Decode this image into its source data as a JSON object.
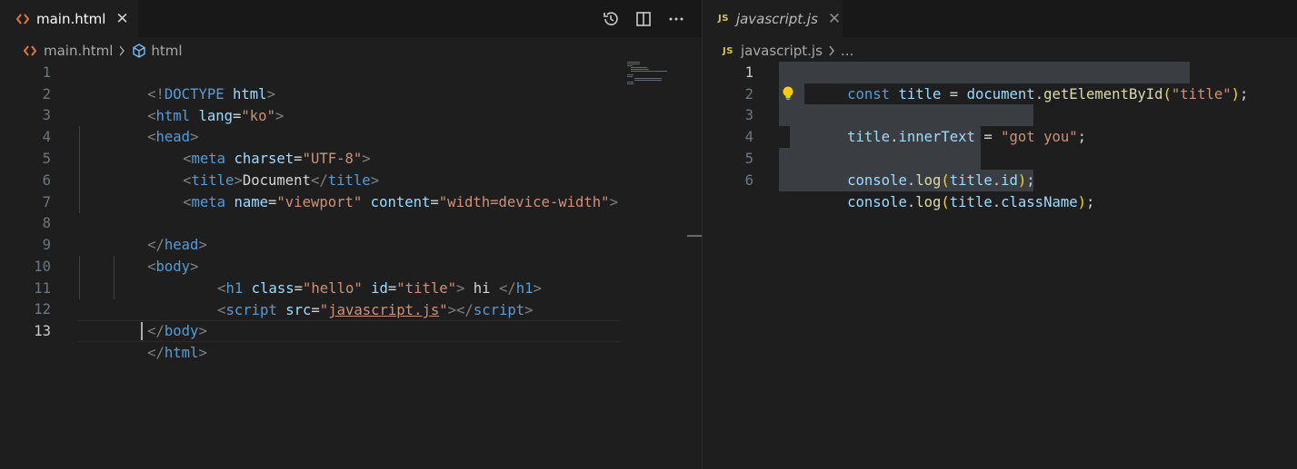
{
  "left_editor": {
    "tab": {
      "label": "main.html",
      "close_glyph": "✕"
    },
    "actions": [
      "history-icon",
      "split-editor-icon",
      "more-actions-icon"
    ],
    "breadcrumb": {
      "file": "main.html",
      "element": "html"
    },
    "line_numbers": [
      "1",
      "2",
      "3",
      "4",
      "5",
      "6",
      "7",
      "8",
      "9",
      "10",
      "11",
      "12",
      "13"
    ],
    "current_line": "13",
    "lines": [
      {
        "t1": "<!",
        "t2": "DOCTYPE",
        "t3": " ",
        "t4": "html",
        "t5": ">"
      },
      {
        "t1": "<",
        "t2": "html",
        "t3": " lang",
        "t4": "=",
        "t5": "\"ko\"",
        "t6": ">"
      },
      {
        "t1": "<",
        "t2": "head",
        "t3": ">"
      },
      {
        "t1": "<",
        "t2": "meta",
        "t3": " charset",
        "t4": "=",
        "t5": "\"UTF-8\"",
        "t6": ">"
      },
      {
        "t1": "<",
        "t2": "title",
        "t3": ">",
        "t4": "Document",
        "t5": "</",
        "t6": "title",
        "t7": ">"
      },
      {
        "t1": "<",
        "t2": "meta",
        "t3": " name",
        "t4": "=",
        "t5": "\"viewport\"",
        "t6": " content",
        "t7": "=",
        "t8": "\"width=device-width\"",
        "t9": ">"
      },
      {},
      {
        "t1": "</",
        "t2": "head",
        "t3": ">"
      },
      {
        "t1": "<",
        "t2": "body",
        "t3": ">"
      },
      {
        "t1": "<",
        "t2": "h1",
        "t3": " class",
        "t4": "=",
        "t5": "\"hello\"",
        "t6": " id",
        "t7": "=",
        "t8": "\"title\"",
        "t9": ">",
        "t10": " hi ",
        "t11": "</",
        "t12": "h1",
        "t13": ">"
      },
      {
        "t1": "<",
        "t2": "script",
        "t3": " src",
        "t4": "=",
        "t5": "\"",
        "t6": "javascript.js",
        "t7": "\"",
        "t8": "></",
        "t9": "script",
        "t10": ">"
      },
      {
        "t1": "</",
        "t2": "body",
        "t3": ">"
      },
      {
        "t1": "</",
        "t2": "html",
        "t3": ">"
      }
    ]
  },
  "right_editor": {
    "tab": {
      "badge": "JS",
      "label": "javascript.js",
      "close_glyph": "✕"
    },
    "breadcrumb": {
      "badge": "JS",
      "file": "javascript.js",
      "more": "..."
    },
    "line_numbers": [
      "1",
      "2",
      "3",
      "4",
      "5",
      "6"
    ],
    "current_line": "1",
    "lines": [
      {
        "t1": "const",
        "t2": " ",
        "t3": "title",
        "t4": " = ",
        "t5": "document",
        "t6": ".",
        "t7": "getElementById",
        "t8": "(",
        "t9": "\"title\"",
        "t10": ")",
        "t11": ";"
      },
      {},
      {
        "t1": "title",
        "t2": ".",
        "t3": "innerText",
        "t4": " = ",
        "t5": "\"got you\"",
        "t6": ";"
      },
      {},
      {
        "t1": "console",
        "t2": ".",
        "t3": "log",
        "t4": "(",
        "t5": "title",
        "t6": ".",
        "t7": "id",
        "t8": ")",
        "t9": ";"
      },
      {
        "t1": "console",
        "t2": ".",
        "t3": "log",
        "t4": "(",
        "t5": "title",
        "t6": ".",
        "t7": "className",
        "t8": ")",
        "t9": ";"
      }
    ],
    "lightbulb_icon": "lightbulb-icon"
  },
  "colors": {
    "background": "#1e1e1e",
    "tab_bar": "#181818",
    "tag": "#569cd6",
    "attribute": "#9cdcfe",
    "string": "#ce9178",
    "function": "#dcdcaa",
    "selection": "#3a3d41",
    "html_icon": "#e37933",
    "js_badge": "#d8c456"
  }
}
